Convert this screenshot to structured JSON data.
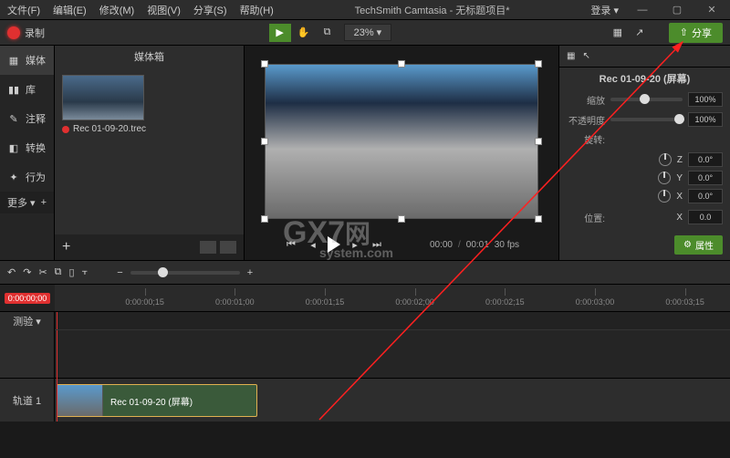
{
  "menubar": {
    "items": [
      "文件(F)",
      "编辑(E)",
      "修改(M)",
      "视图(V)",
      "分享(S)",
      "帮助(H)"
    ],
    "title": "TechSmith Camtasia - 无标题项目*",
    "login": "登录 ▾"
  },
  "toolbar": {
    "record": "录制",
    "zoom": "23%",
    "share": "分享"
  },
  "sidenav": {
    "items": [
      "媒体",
      "库",
      "注释",
      "转换",
      "行为"
    ],
    "more": "更多 ▾",
    "plus": "+"
  },
  "bin": {
    "title": "媒体箱",
    "clip": "Rec 01-09-20.trec",
    "plus": "+"
  },
  "canvas": {
    "time_cur": "00:00",
    "time_total": "00:01",
    "fps": "30 fps"
  },
  "props": {
    "clipname": "Rec 01-09-20 (屏幕)",
    "scale_label": "缩放",
    "scale_value": "100%",
    "opacity_label": "不透明度",
    "opacity_value": "100%",
    "rotate_label": "旋转:",
    "rot_z": "Z",
    "rot_z_val": "0.0°",
    "rot_y": "Y",
    "rot_y_val": "0.0°",
    "rot_x": "X",
    "rot_x_val": "0.0°",
    "pos_label": "位置:",
    "pos_x": "X",
    "pos_x_val": "0.0",
    "btn": "属性"
  },
  "timeline": {
    "playhead": "0:00:00;00",
    "ticks": [
      "0:00:00;15",
      "0:00:01;00",
      "0:00:01;15",
      "0:00:02;00",
      "0:00:02;15",
      "0:00:03;00",
      "0:00:03;15"
    ],
    "trackhead": "测验 ▾",
    "trackname": "轨道 1",
    "clipname": "Rec 01-09-20 (屏幕)"
  },
  "watermark": {
    "big": "GX7",
    "small": "system.com",
    "suffix": "网"
  }
}
